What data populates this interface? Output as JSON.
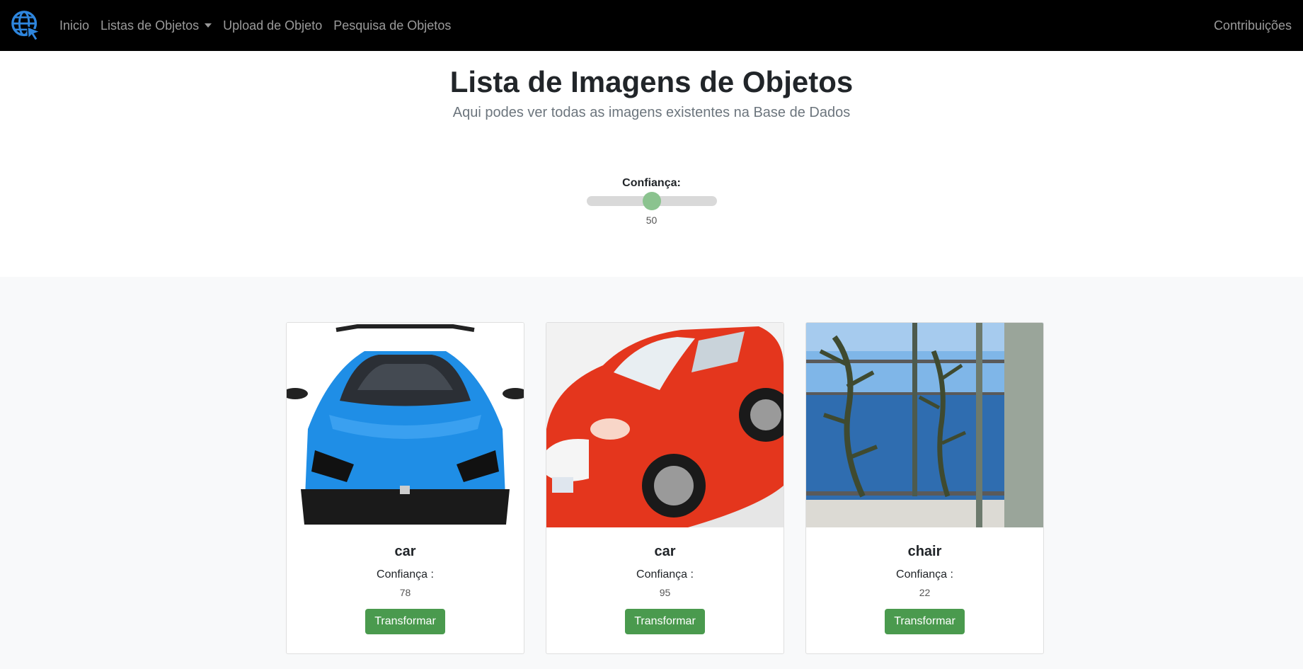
{
  "nav": {
    "logo_icon": "globe-cursor-icon",
    "items": [
      {
        "label": "Inicio"
      },
      {
        "label": "Listas de Objetos",
        "dropdown": true
      },
      {
        "label": "Upload de Objeto"
      },
      {
        "label": "Pesquisa de Objetos"
      }
    ],
    "right_label": "Contribuições"
  },
  "hero": {
    "title": "Lista de Imagens de Objetos",
    "subtitle": "Aqui podes ver todas as imagens existentes na Base de Dados"
  },
  "slider": {
    "label": "Confiança:",
    "value": "50",
    "fraction": 0.5,
    "thumb_color": "#8bc38f"
  },
  "cards": [
    {
      "title": "car",
      "confidence_label": "Confiança :",
      "confidence_value": "78",
      "button_label": "Transformar",
      "image": "blue-sports-car"
    },
    {
      "title": "car",
      "confidence_label": "Confiança :",
      "confidence_value": "95",
      "button_label": "Transformar",
      "image": "red-sports-car"
    },
    {
      "title": "chair",
      "confidence_label": "Confiança :",
      "confidence_value": "22",
      "button_label": "Transformar",
      "image": "balcony-sea-view"
    }
  ],
  "colors": {
    "navbar_bg": "#000000",
    "button_bg": "#4a9a4e",
    "logo": "#2e86de"
  }
}
